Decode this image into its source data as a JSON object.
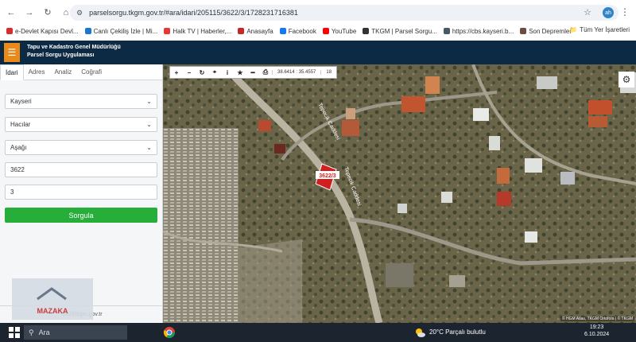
{
  "browser": {
    "url": "parselsorgu.tkgm.gov.tr/#ara/idari/205115/3622/3/1728231716381",
    "profile_initials": "ah",
    "bookmarks": [
      {
        "label": "e-Devlet Kapısı Devl...",
        "color": "#d32f2f"
      },
      {
        "label": "Canlı Çekiliş İzle | Mi...",
        "color": "#1976d2"
      },
      {
        "label": "Halk TV | Haberler,...",
        "color": "#e53935"
      },
      {
        "label": "Anasayfa",
        "color": "#c62828"
      },
      {
        "label": "Facebook",
        "color": "#1877f2"
      },
      {
        "label": "YouTube",
        "color": "#ff0000"
      },
      {
        "label": "TKGM | Parsel Sorgu...",
        "color": "#333333"
      },
      {
        "label": "https://cbs.kayseri.b...",
        "color": "#455a64"
      },
      {
        "label": "Son Depremler",
        "color": "#6d4c41"
      }
    ],
    "all_bookmarks_label": "Tüm Yer İşaretleri"
  },
  "app": {
    "title_line1": "Tapu ve Kadastro Genel Müdürlüğü",
    "title_line2": "Parsel Sorgu Uygulaması",
    "accent_color": "#e88b1c"
  },
  "panel": {
    "tabs": [
      "İdari",
      "Adres",
      "Analiz",
      "Coğrafi"
    ],
    "active_tab": "İdari",
    "province": "Kayseri",
    "district": "Hacılar",
    "neighborhood": "Aşağı",
    "block": "3622",
    "parcel": "3",
    "query_button": "Sorgula",
    "footer_email": "cbs@tkgm.gov.tr"
  },
  "map": {
    "coords": "38.6414 : 35.4557",
    "zoom": "18",
    "parcel_label": "3622/3",
    "road_label_1": "Tepecik Caddesi",
    "road_label_2": "Tepecik Caddesi",
    "attribution": "© HGM Atlas, TKGM Ortofoto | © TKGM"
  },
  "watermark": {
    "text": "MAZAKA"
  },
  "taskbar": {
    "search_placeholder": "Ara",
    "weather": "20°C  Parçalı bulutlu",
    "time": "19:23",
    "date": "6.10.2024"
  }
}
